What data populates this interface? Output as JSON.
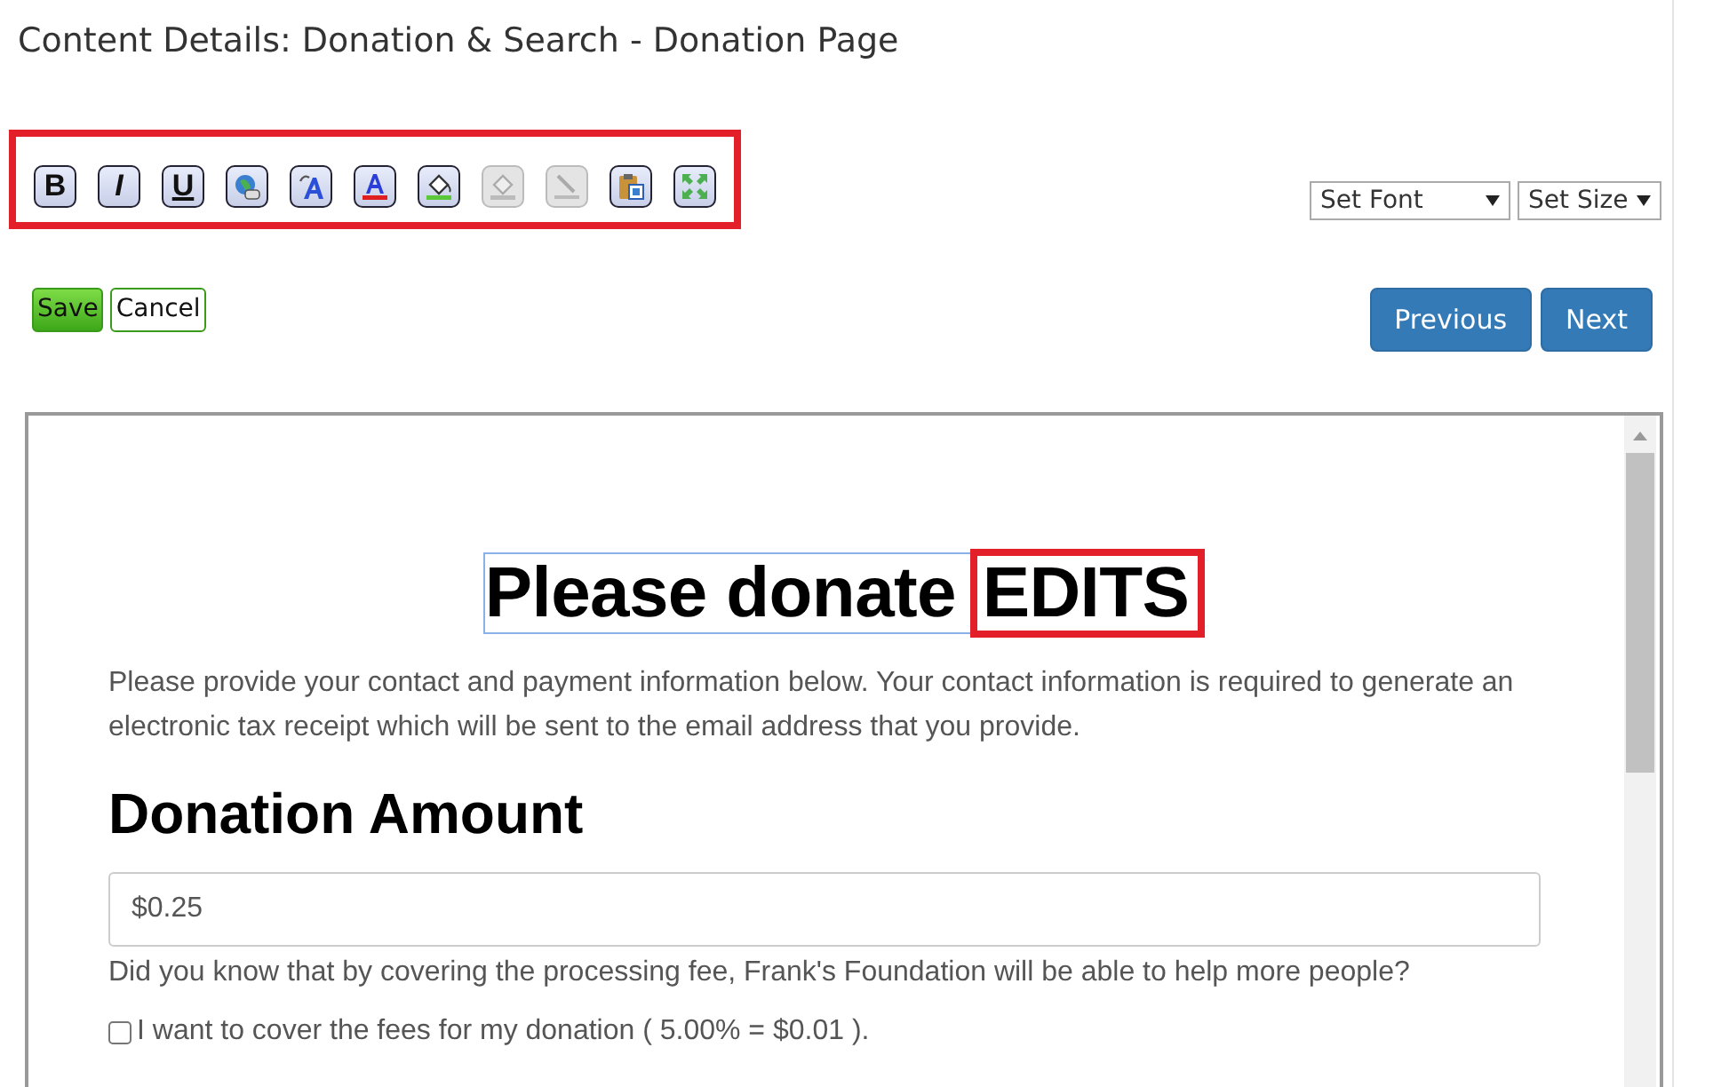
{
  "title": "Content Details: Donation & Search - Donation Page",
  "toolbar": {
    "highlighted": true,
    "buttons": [
      {
        "kind": "bold",
        "label": "B",
        "disabled": false
      },
      {
        "kind": "italic",
        "label": "I",
        "disabled": false
      },
      {
        "kind": "underline",
        "label": "U",
        "disabled": false
      },
      {
        "kind": "link",
        "disabled": false
      },
      {
        "kind": "clear",
        "disabled": false
      },
      {
        "kind": "fontcolor",
        "disabled": false
      },
      {
        "kind": "highlight",
        "disabled": false
      },
      {
        "kind": "eraser",
        "disabled": true
      },
      {
        "kind": "rule",
        "disabled": true
      },
      {
        "kind": "paste",
        "disabled": false
      },
      {
        "kind": "fullscreen",
        "disabled": false
      }
    ]
  },
  "selects": [
    {
      "value": "Set Font"
    },
    {
      "value": "Set Size"
    }
  ],
  "actions": [
    {
      "label": "Save",
      "kind": "save"
    },
    {
      "label": "Cancel",
      "kind": "cancel"
    }
  ],
  "nav": [
    {
      "label": "Previous"
    },
    {
      "label": "Next"
    }
  ],
  "editor": {
    "heading": {
      "focused": true,
      "parts": [
        {
          "text": "Please donate",
          "highlighted": false
        },
        {
          "text": "EDITS",
          "highlighted": true
        }
      ]
    },
    "intro": "Please provide your contact and payment information below. Your contact information is required to generate an electronic tax receipt which will be sent to the email address that you provide.",
    "section_title": "Donation Amount",
    "amount": {
      "value": "$0.25"
    },
    "fee_note": "Did you know that by covering the processing fee, Frank's Foundation will be able to help more people?",
    "cover_fees": {
      "label": "I want to cover the fees for my donation ( 5.00% = $0.01 ).",
      "checked": false
    }
  }
}
